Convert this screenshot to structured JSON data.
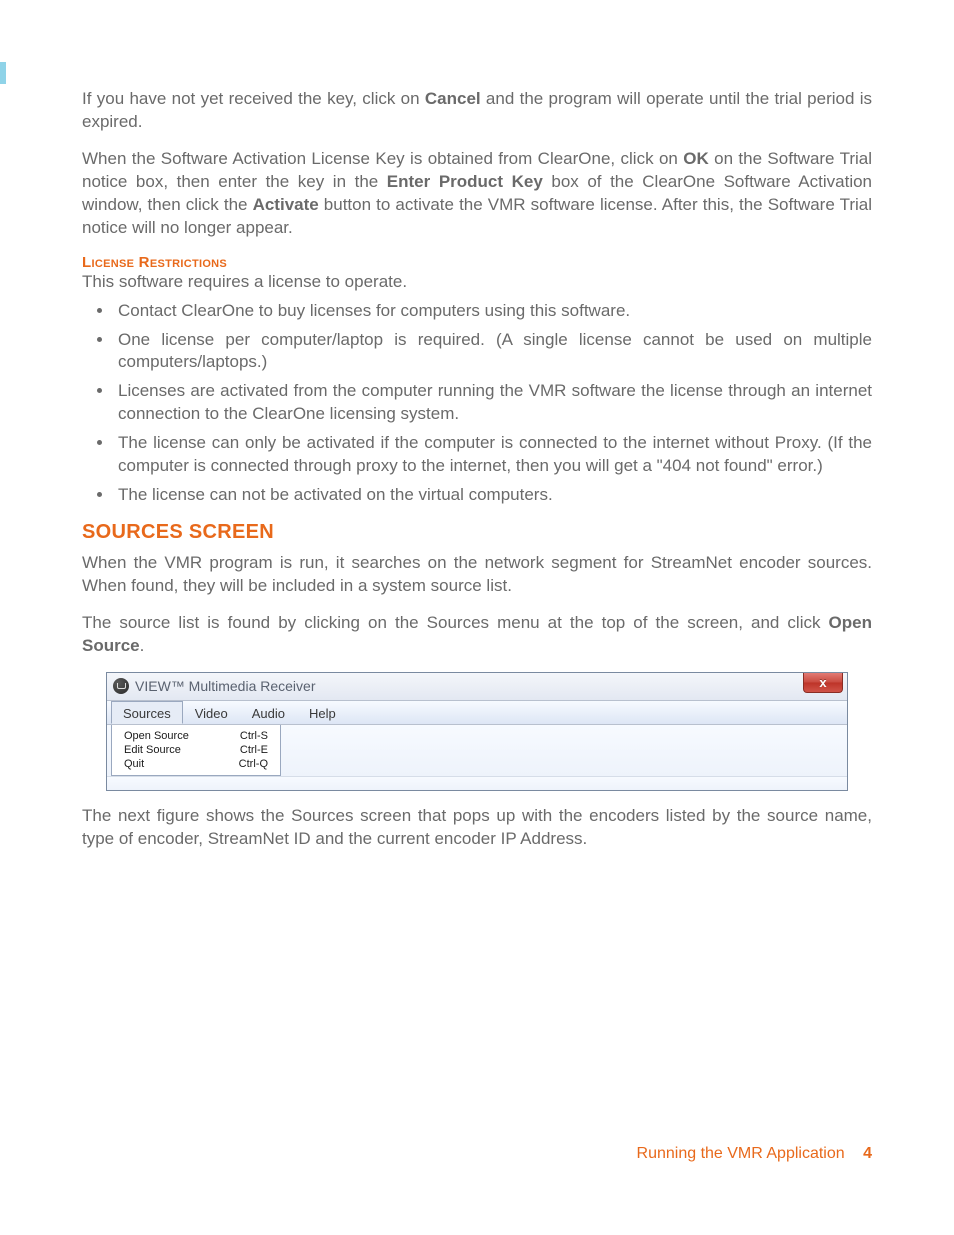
{
  "para1": {
    "pre": "If you have not yet received the key, click on ",
    "b1": "Cancel",
    "post": " and the program will operate until the trial period is expired."
  },
  "para2": {
    "t1": "When the Software Activation License Key is obtained from ClearOne, click on ",
    "b1": "OK",
    "t2": " on the Software Trial notice box, then enter the key in the ",
    "b2": "Enter Product Key",
    "t3": " box of the ClearOne Software Activation window, then click the ",
    "b3": "Activate",
    "t4": " button to activate the VMR software license. After this, the Software Trial notice will no longer appear."
  },
  "subhead1": "License Restrictions",
  "para3": "This software requires a license to operate.",
  "bullets": [
    "Contact ClearOne to buy licenses for computers using this software.",
    "One license per computer/laptop is required. (A single license cannot be used on multiple computers/laptops.)",
    "Licenses are activated from the computer running the VMR software the license through an internet connection to the ClearOne licensing system.",
    "The license can only be activated if the computer is connected to the internet without Proxy. (If the computer is connected through proxy to the internet, then you will get a \"404 not found\" error.)",
    "The license can not be activated on the virtual computers."
  ],
  "heading1": "Sources Screen",
  "para4": "When the VMR program is run, it searches on the network segment for StreamNet encoder sources. When found, they will be included in a system source list.",
  "para5": {
    "t1": "The source list is found by clicking on the Sources menu at the top of the screen, and click ",
    "b1": "Open Source",
    "t2": "."
  },
  "ui": {
    "title": "VIEW™ Multimedia Receiver",
    "close": "x",
    "menus": [
      "Sources",
      "Video",
      "Audio",
      "Help"
    ],
    "dropdown": [
      {
        "label": "Open Source",
        "shortcut": "Ctrl-S"
      },
      {
        "label": "Edit Source",
        "shortcut": "Ctrl-E"
      },
      {
        "label": "Quit",
        "shortcut": "Ctrl-Q"
      }
    ]
  },
  "para6": "The next figure shows the Sources screen that pops up with the encoders listed by the source name, type of encoder, StreamNet ID and the current encoder IP Address.",
  "footer": {
    "section": "Running the VMR Application",
    "page": "4"
  }
}
